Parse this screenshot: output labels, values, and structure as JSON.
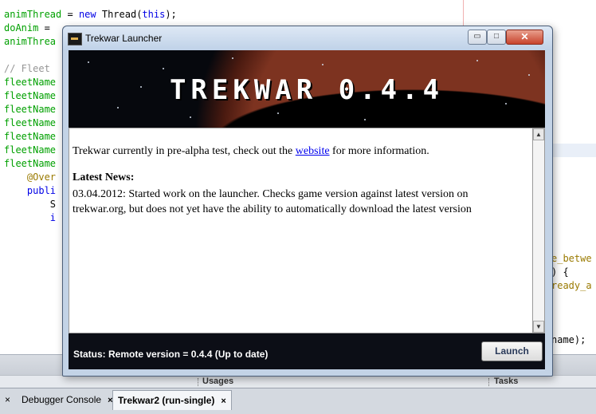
{
  "ide": {
    "code_lines": [
      [
        {
          "t": "animThread",
          "c": "c-green"
        },
        {
          "t": " = "
        },
        {
          "t": "new",
          "c": "c-kw"
        },
        {
          "t": " Thread("
        },
        {
          "t": "this",
          "c": "c-kw"
        },
        {
          "t": ");"
        }
      ],
      [
        {
          "t": "doAnim",
          "c": "c-green"
        },
        {
          "t": " = "
        }
      ],
      [
        {
          "t": "animThrea",
          "c": "c-green"
        }
      ],
      [
        {
          "t": ""
        }
      ],
      [
        {
          "t": "// Fleet",
          "c": "c-gray"
        }
      ],
      [
        {
          "t": "fleetName",
          "c": "c-green"
        }
      ],
      [
        {
          "t": "fleetName",
          "c": "c-green"
        }
      ],
      [
        {
          "t": "fleetName",
          "c": "c-green"
        }
      ],
      [
        {
          "t": "fleetName",
          "c": "c-green"
        }
      ],
      [
        {
          "t": "fleetName",
          "c": "c-green"
        }
      ],
      [
        {
          "t": "fleetName",
          "c": "c-green"
        }
      ],
      [
        {
          "t": "fleetName",
          "c": "c-green"
        }
      ],
      [
        {
          "t": "    @Over",
          "c": "c-olive"
        }
      ],
      [
        {
          "t": "    publi",
          "c": "c-kw"
        }
      ],
      [
        {
          "t": "        S"
        }
      ],
      [
        {
          "t": "        i",
          "c": "c-kw"
        }
      ]
    ],
    "right_fragments": [
      {
        "text": "e_betwe",
        "class": "c-olive",
        "line": 18
      },
      {
        "text": ") {",
        "class": "",
        "line": 19
      },
      {
        "text": "ready_a",
        "class": "c-olive",
        "line": 20
      },
      {
        "text": "name);",
        "class": "",
        "line": 24
      }
    ],
    "panels": [
      "Usages",
      "Tasks"
    ],
    "tabs": [
      {
        "label": "Debugger Console",
        "active": false,
        "close": "×"
      },
      {
        "label": "Trekwar2 (run-single)",
        "active": true,
        "close": "×"
      }
    ],
    "leading_close": "×"
  },
  "launcher": {
    "title": "Trekwar Launcher",
    "minimize_icon": "▭",
    "maximize_icon": "□",
    "close_icon": "✕",
    "banner_title": "TREKWAR 0.4.4",
    "intro_before": "Trekwar currently in pre-alpha test, check out the ",
    "intro_link": "website",
    "intro_after": " for more information.",
    "news_heading": "Latest News:",
    "news_body": "03.04.2012: Started work on the launcher. Checks game version against latest version on trekwar.org, but does not yet have the ability to automatically download the latest version",
    "status": "Status: Remote version = 0.4.4 (Up to date)",
    "launch_label": "Launch",
    "scroll_up_icon": "▲",
    "scroll_down_icon": "▼"
  }
}
